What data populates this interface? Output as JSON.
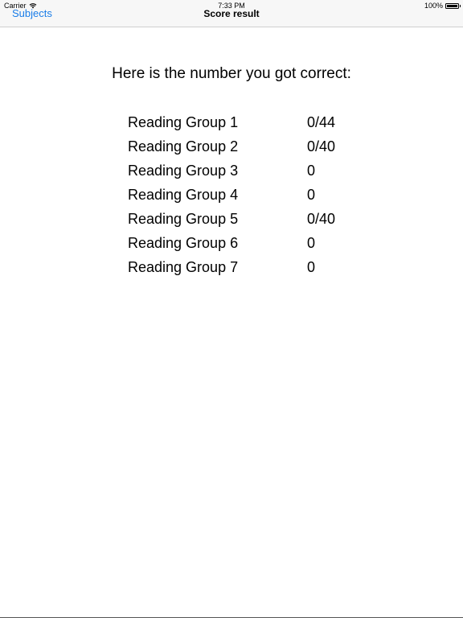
{
  "status_bar": {
    "carrier": "Carrier",
    "time": "7:33 PM",
    "battery": "100%"
  },
  "nav": {
    "back_label": "Subjects",
    "title": "Score result"
  },
  "intro": "Here is the number you got correct:",
  "scores": [
    {
      "label": "Reading Group 1",
      "value": "0/44"
    },
    {
      "label": "Reading Group 2",
      "value": "0/40"
    },
    {
      "label": "Reading Group 3",
      "value": "0"
    },
    {
      "label": "Reading Group 4",
      "value": "0"
    },
    {
      "label": "Reading Group 5",
      "value": "0/40"
    },
    {
      "label": "Reading Group 6",
      "value": "0"
    },
    {
      "label": "Reading Group 7",
      "value": "0"
    }
  ],
  "colors": {
    "accent": "#1a7de8",
    "nav_background": "#f7f7f7"
  }
}
